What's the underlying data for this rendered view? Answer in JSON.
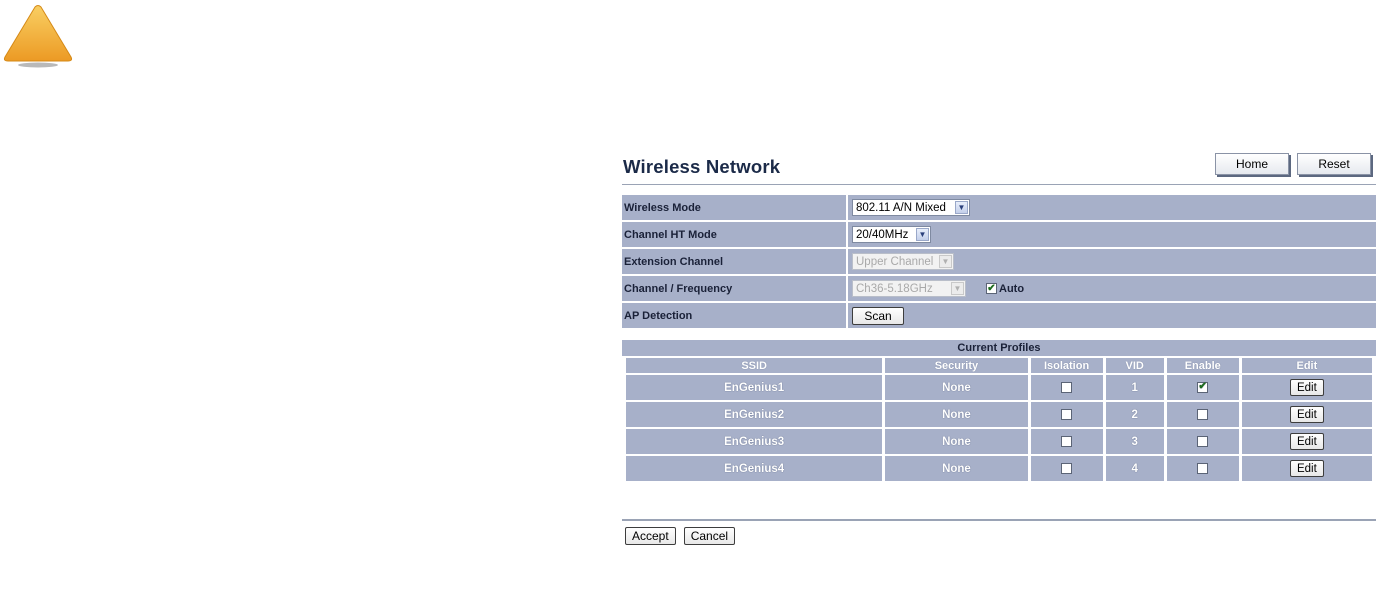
{
  "header": {
    "title": "Wireless Network",
    "home_label": "Home",
    "reset_label": "Reset"
  },
  "settings": {
    "wireless_mode": {
      "label": "Wireless Mode",
      "value": "802.11 A/N Mixed"
    },
    "channel_ht_mode": {
      "label": "Channel HT Mode",
      "value": "20/40MHz"
    },
    "extension_channel": {
      "label": "Extension Channel",
      "value": "Upper Channel",
      "disabled": true
    },
    "channel_frequency": {
      "label": "Channel / Frequency",
      "value": "Ch36-5.18GHz",
      "disabled": true,
      "auto_label": "Auto",
      "auto_checked": true
    },
    "ap_detection": {
      "label": "AP Detection",
      "button_label": "Scan"
    }
  },
  "profiles": {
    "title": "Current Profiles",
    "columns": [
      "SSID",
      "Security",
      "Isolation",
      "VID",
      "Enable",
      "Edit"
    ],
    "rows": [
      {
        "ssid": "EnGenius1",
        "security": "None",
        "isolation": false,
        "vid": "1",
        "enable": true,
        "edit_label": "Edit"
      },
      {
        "ssid": "EnGenius2",
        "security": "None",
        "isolation": false,
        "vid": "2",
        "enable": false,
        "edit_label": "Edit"
      },
      {
        "ssid": "EnGenius3",
        "security": "None",
        "isolation": false,
        "vid": "3",
        "enable": false,
        "edit_label": "Edit"
      },
      {
        "ssid": "EnGenius4",
        "security": "None",
        "isolation": false,
        "vid": "4",
        "enable": false,
        "edit_label": "Edit"
      }
    ]
  },
  "footer": {
    "accept_label": "Accept",
    "cancel_label": "Cancel"
  },
  "icons": {
    "warning": "warning-triangle-icon",
    "dropdown": "chevron-down-icon",
    "check": "checkmark-icon"
  },
  "colors": {
    "row_background": "#a7b0c9",
    "title_color": "#1b2a48",
    "warning_fill": "#f0a72c"
  }
}
